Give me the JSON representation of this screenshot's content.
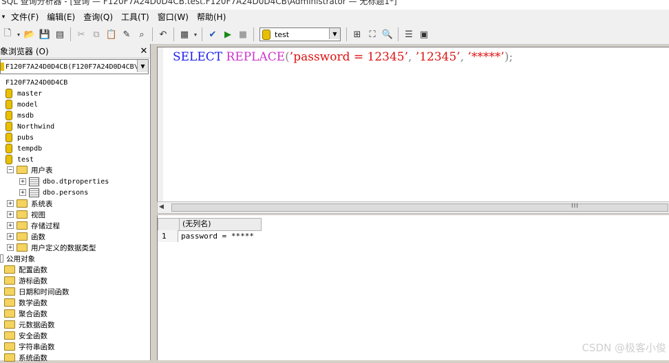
{
  "window": {
    "title": "SQL 查询分析器 - [查询 — F120F7A24D0D4CB.test.F120F7A24D0D4CB\\Administrator — 无标题1*]"
  },
  "menu": {
    "items": [
      "文件(F)",
      "编辑(E)",
      "查询(Q)",
      "工具(T)",
      "窗口(W)",
      "帮助(H)"
    ]
  },
  "toolbar": {
    "database_selected": "test"
  },
  "object_browser": {
    "title": "象浏览器 (O)",
    "server_combo": "F120F7A24D0D4CB(F120F7A24D0D4CB\\",
    "server_node": "F120F7A24D0D4CB",
    "databases": [
      "master",
      "model",
      "msdb",
      "Northwind",
      "pubs",
      "tempdb",
      "test"
    ],
    "user_tables_label": "用户表",
    "user_tables": [
      "dbo.dtproperties",
      "dbo.persons"
    ],
    "test_folders": [
      "系统表",
      "视图",
      "存储过程",
      "函数",
      "用户定义的数据类型"
    ],
    "common_objects_label": "公用对象",
    "common_folders": [
      "配置函数",
      "游标函数",
      "日期和时间函数",
      "数学函数",
      "聚合函数",
      "元数据函数",
      "安全函数",
      "字符串函数",
      "系统函数"
    ]
  },
  "editor": {
    "kw_select": "SELECT",
    "kw_func": "REPLACE",
    "open_paren": "(",
    "arg1": "’password = 12345’",
    "comma": ",",
    "arg2": "’12345’",
    "arg3": "’*****’",
    "close": ");"
  },
  "results": {
    "column_header": "(无列名)",
    "row_number": "1",
    "cell_value": "password = *****"
  },
  "watermark": "CSDN @极客小俊"
}
